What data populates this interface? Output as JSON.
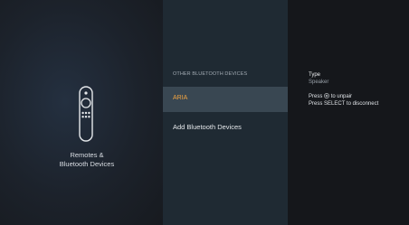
{
  "settings": {
    "title_line1": "Remotes &",
    "title_line2": "Bluetooth Devices",
    "icon": "fire-tv-remote-icon"
  },
  "devices": {
    "section_label": "OTHER BLUETOOTH DEVICES",
    "items": [
      {
        "label": "ARIA",
        "selected": true
      }
    ],
    "add_label": "Add Bluetooth Devices"
  },
  "details": {
    "type_label": "Type",
    "type_value": "Speaker",
    "press_prefix": "Press",
    "press_icon": "menu-button-icon",
    "press_suffix": "to unpair",
    "select_instruction": "Press SELECT to disconnect"
  },
  "colors": {
    "accent": "#f0a341",
    "selected_row": "#394752",
    "center_panel": "#1f2a33",
    "right_panel": "#15171b"
  }
}
